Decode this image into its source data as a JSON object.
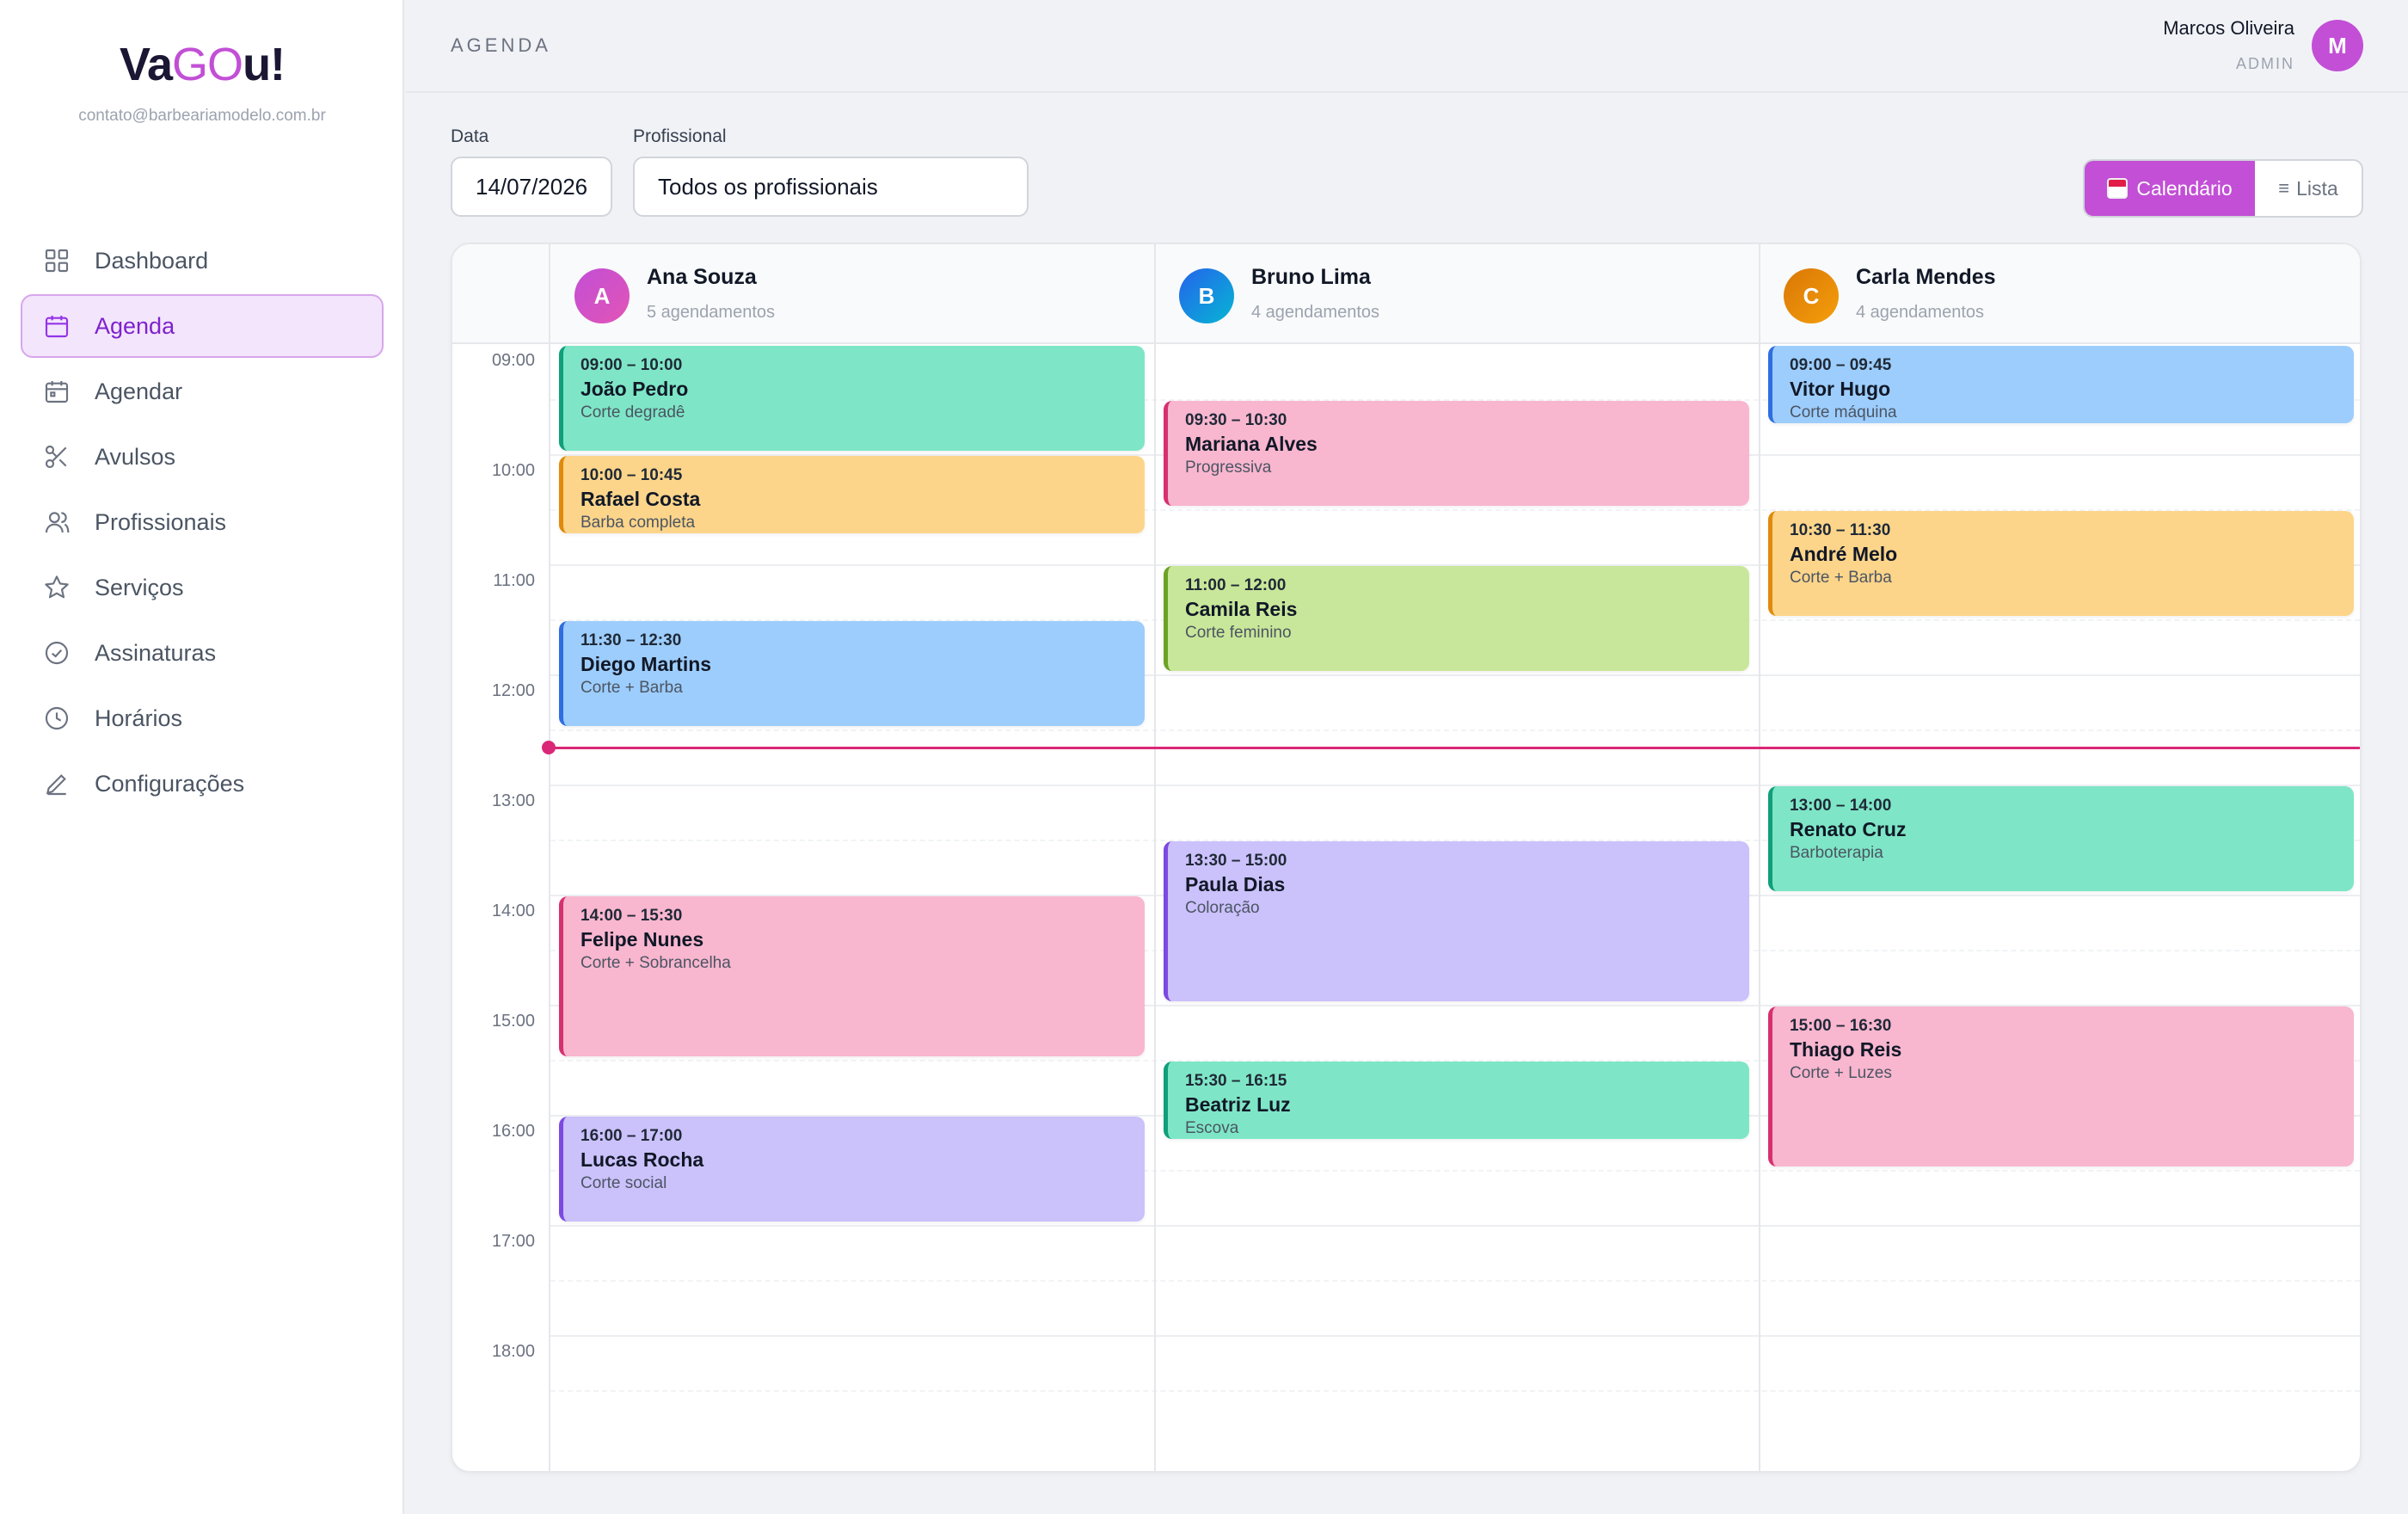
{
  "app": {
    "logo_a": "Va",
    "logo_b": "GO",
    "logo_c": "u!",
    "email": "contato@barbeariamodelo.com.br"
  },
  "nav": {
    "items": [
      {
        "label": "Dashboard",
        "icon": "grid-icon"
      },
      {
        "label": "Agenda",
        "icon": "calendar-icon",
        "active": true
      },
      {
        "label": "Agendar",
        "icon": "calendar-add-icon"
      },
      {
        "label": "Avulsos",
        "icon": "scissors-icon"
      },
      {
        "label": "Profissionais",
        "icon": "users-icon"
      },
      {
        "label": "Serviços",
        "icon": "star-icon"
      },
      {
        "label": "Assinaturas",
        "icon": "check-circle-icon"
      },
      {
        "label": "Horários",
        "icon": "clock-icon"
      },
      {
        "label": "Configurações",
        "icon": "pen-icon"
      }
    ]
  },
  "header": {
    "title": "AGENDA",
    "user_name": "Marcos Oliveira",
    "user_role": "ADMIN",
    "user_initial": "M"
  },
  "filters": {
    "date_label": "Data",
    "date_value": "14/07/2026",
    "professional_label": "Profissional",
    "professional_value": "Todos os profissionais"
  },
  "view_toggle": {
    "calendar_label": "Calendário",
    "list_label": "Lista",
    "active": "calendar"
  },
  "calendar": {
    "hours": [
      "09:00",
      "10:00",
      "11:00",
      "12:00",
      "13:00",
      "14:00",
      "15:00",
      "16:00",
      "17:00",
      "18:00"
    ],
    "now": "12:40",
    "now_color": "#db2777",
    "professionals": [
      {
        "initial": "A",
        "name": "Ana Souza",
        "count": "5 agendamentos",
        "avatar_from": "#c24fd6",
        "avatar_to": "#e254b6",
        "appointments": [
          {
            "start": "09:00",
            "end": "10:00",
            "time": "09:00 – 10:00",
            "client": "João Pedro",
            "service": "Corte degradê",
            "color": "green"
          },
          {
            "start": "10:00",
            "end": "10:45",
            "time": "10:00 – 10:45",
            "client": "Rafael Costa",
            "service": "Barba completa",
            "color": "orange"
          },
          {
            "start": "11:30",
            "end": "12:30",
            "time": "11:30 – 12:30",
            "client": "Diego Martins",
            "service": "Corte + Barba",
            "color": "blue"
          },
          {
            "start": "14:00",
            "end": "15:30",
            "time": "14:00 – 15:30",
            "client": "Felipe Nunes",
            "service": "Corte + Sobrancelha",
            "color": "pink"
          },
          {
            "start": "16:00",
            "end": "17:00",
            "time": "16:00 – 17:00",
            "client": "Lucas Rocha",
            "service": "Corte social",
            "color": "purple"
          }
        ]
      },
      {
        "initial": "B",
        "name": "Bruno Lima",
        "count": "4 agendamentos",
        "avatar_from": "#2563eb",
        "avatar_to": "#06b6d4",
        "appointments": [
          {
            "start": "09:30",
            "end": "10:30",
            "time": "09:30 – 10:30",
            "client": "Mariana Alves",
            "service": "Progressiva",
            "color": "pink"
          },
          {
            "start": "11:00",
            "end": "12:00",
            "time": "11:00 – 12:00",
            "client": "Camila Reis",
            "service": "Corte feminino",
            "color": "lime"
          },
          {
            "start": "13:30",
            "end": "15:00",
            "time": "13:30 – 15:00",
            "client": "Paula Dias",
            "service": "Coloração",
            "color": "purple"
          },
          {
            "start": "15:30",
            "end": "16:15",
            "time": "15:30 – 16:15",
            "client": "Beatriz Luz",
            "service": "Escova",
            "color": "green"
          }
        ]
      },
      {
        "initial": "C",
        "name": "Carla Mendes",
        "count": "4 agendamentos",
        "avatar_from": "#d97706",
        "avatar_to": "#f59e0b",
        "appointments": [
          {
            "start": "09:00",
            "end": "09:45",
            "time": "09:00 – 09:45",
            "client": "Vitor Hugo",
            "service": "Corte máquina",
            "color": "blue"
          },
          {
            "start": "10:30",
            "end": "11:30",
            "time": "10:30 – 11:30",
            "client": "André Melo",
            "service": "Corte + Barba",
            "color": "orange"
          },
          {
            "start": "13:00",
            "end": "14:00",
            "time": "13:00 – 14:00",
            "client": "Renato Cruz",
            "service": "Barboterapia",
            "color": "green"
          },
          {
            "start": "15:00",
            "end": "16:30",
            "time": "15:00 – 16:30",
            "client": "Thiago Reis",
            "service": "Corte + Luzes",
            "color": "pink"
          }
        ]
      }
    ]
  }
}
